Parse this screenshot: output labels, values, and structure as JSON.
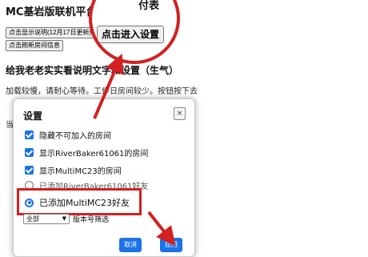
{
  "page": {
    "title": "MC基岩版联机平台 房",
    "title_suffix": "",
    "buttons": {
      "explain_label": "点击显示说明(12月17日更新)",
      "refresh_label": "点击刷新房间信息"
    },
    "section_heading": "给我老老实实看说明文字和设置（生气）",
    "loading_text": "加载较慢，请耐心等待。工作日房间较少。按钮按下去",
    "bg_letter": "当"
  },
  "zoom": {
    "button_label": "点击进入设置",
    "top_fragment": "付表"
  },
  "dialog": {
    "title": "设置",
    "close_label": "×",
    "options": [
      {
        "label": "隐藏不可加入的房间",
        "kind": "checkbox",
        "checked": true
      },
      {
        "label": "显示RiverBaker61061的房间",
        "kind": "checkbox",
        "checked": true
      },
      {
        "label": "显示MultiMC23的房间",
        "kind": "checkbox",
        "checked": true
      },
      {
        "label": "已添加RiverBaker61061好友",
        "kind": "radio",
        "checked": false
      },
      {
        "label": "已添加MultiMC23好友",
        "kind": "radio",
        "checked": true
      }
    ],
    "filter": {
      "select_value": "全部",
      "label": "版本号筛选"
    },
    "cancel_label": "取消",
    "apply_label": "应用"
  },
  "colors": {
    "annotation_red": "#d32020",
    "accent_blue": "#1a73e8"
  }
}
